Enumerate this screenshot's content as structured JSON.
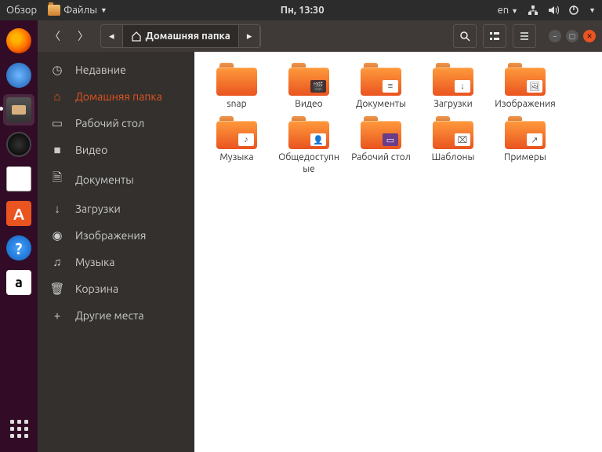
{
  "topbar": {
    "activities": "Обзор",
    "files_menu": "Файлы",
    "clock": "Пн, 13:30",
    "lang": "en"
  },
  "path": {
    "current": "Домашняя папка"
  },
  "sidebar": {
    "items": [
      {
        "label": "Недавние"
      },
      {
        "label": "Домашняя папка"
      },
      {
        "label": "Рабочий стол"
      },
      {
        "label": "Видео"
      },
      {
        "label": "Документы"
      },
      {
        "label": "Загрузки"
      },
      {
        "label": "Изображения"
      },
      {
        "label": "Музыка"
      },
      {
        "label": "Корзина"
      },
      {
        "label": "Другие места"
      }
    ]
  },
  "folders": [
    {
      "label": "snap",
      "emblem": ""
    },
    {
      "label": "Видео",
      "emblem": "film"
    },
    {
      "label": "Документы",
      "emblem": "doc"
    },
    {
      "label": "Загрузки",
      "emblem": "dl"
    },
    {
      "label": "Изображения",
      "emblem": "img"
    },
    {
      "label": "Музыка",
      "emblem": "music"
    },
    {
      "label": "Общедоступные",
      "emblem": "pub"
    },
    {
      "label": "Рабочий стол",
      "emblem": "desk"
    },
    {
      "label": "Шаблоны",
      "emblem": "tpl"
    },
    {
      "label": "Примеры",
      "emblem": "link"
    }
  ]
}
